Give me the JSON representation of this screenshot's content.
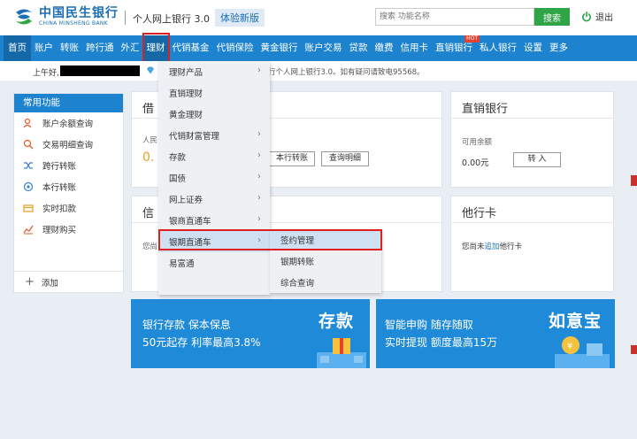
{
  "header": {
    "logo_cn": "中国民生银行",
    "logo_en": "CHINA MINSHENG BANK",
    "title": "个人网上银行 3.0",
    "badge": "体验新版",
    "search_placeholder": "搜索 功能名称",
    "search_button": "搜索",
    "logout": "退出"
  },
  "nav": {
    "items": [
      "首页",
      "账户",
      "转账",
      "跨行通",
      "外汇",
      "理财",
      "代销基金",
      "代销保险",
      "黄金银行",
      "账户交易",
      "贷款",
      "缴费",
      "信用卡",
      "直销银行",
      "私人银行",
      "设置",
      "更多"
    ],
    "active": "理财",
    "hot_badge": "HOT"
  },
  "welcome": {
    "greeting": "上午好,",
    "notice": "行个人网上银行3.0。如有疑问请致电95568。"
  },
  "sidebar": {
    "title": "常用功能",
    "items": [
      "账户余额查询",
      "交易明细查询",
      "跨行转账",
      "本行转账",
      "实时扣款",
      "理财购买"
    ],
    "add": "添加"
  },
  "cards": {
    "debit": {
      "title": "借",
      "currency_label": "人民",
      "amount": "0.",
      "btn_transfer": "本行转账",
      "btn_details": "查询明细"
    },
    "credit": {
      "title": "信",
      "note": "您尚"
    },
    "direct_bank": {
      "title": "直销银行",
      "balance_label": "可用余额",
      "balance": "0.00元",
      "btn_transfer_in": "转 入"
    },
    "other_card": {
      "title": "他行卡",
      "text_before": "您尚未",
      "link": "追加",
      "text_after": "他行卡"
    }
  },
  "banners": {
    "deposit": {
      "line1": "银行存款 保本保息",
      "line2": "50元起存 利率最高3.8%",
      "big": "存款"
    },
    "ruyibao": {
      "line1": "智能申购 随存随取",
      "line2": "实时提现 额度最高15万",
      "big": "如意宝"
    }
  },
  "dropdown": {
    "items": [
      {
        "label": "理财产品",
        "arrow": true
      },
      {
        "label": "直销理财",
        "arrow": false
      },
      {
        "label": "黄金理财",
        "arrow": false
      },
      {
        "label": "代销财富管理",
        "arrow": true
      },
      {
        "label": "存款",
        "arrow": true
      },
      {
        "label": "国债",
        "arrow": true
      },
      {
        "label": "网上证券",
        "arrow": true
      },
      {
        "label": "银商直通车",
        "arrow": true
      },
      {
        "label": "银期直通车",
        "arrow": true
      },
      {
        "label": "易富通",
        "arrow": false
      }
    ],
    "highlighted": "银期直通车",
    "arrow_glyph": "›"
  },
  "submenu": {
    "items": [
      "签约管理",
      "银期转账",
      "综合查询"
    ],
    "highlighted": "签约管理"
  },
  "colors": {
    "nav_blue": "#1e83cf",
    "search_green": "#2fa548",
    "highlight_red": "#e02020",
    "amount_orange": "#f0a020"
  }
}
